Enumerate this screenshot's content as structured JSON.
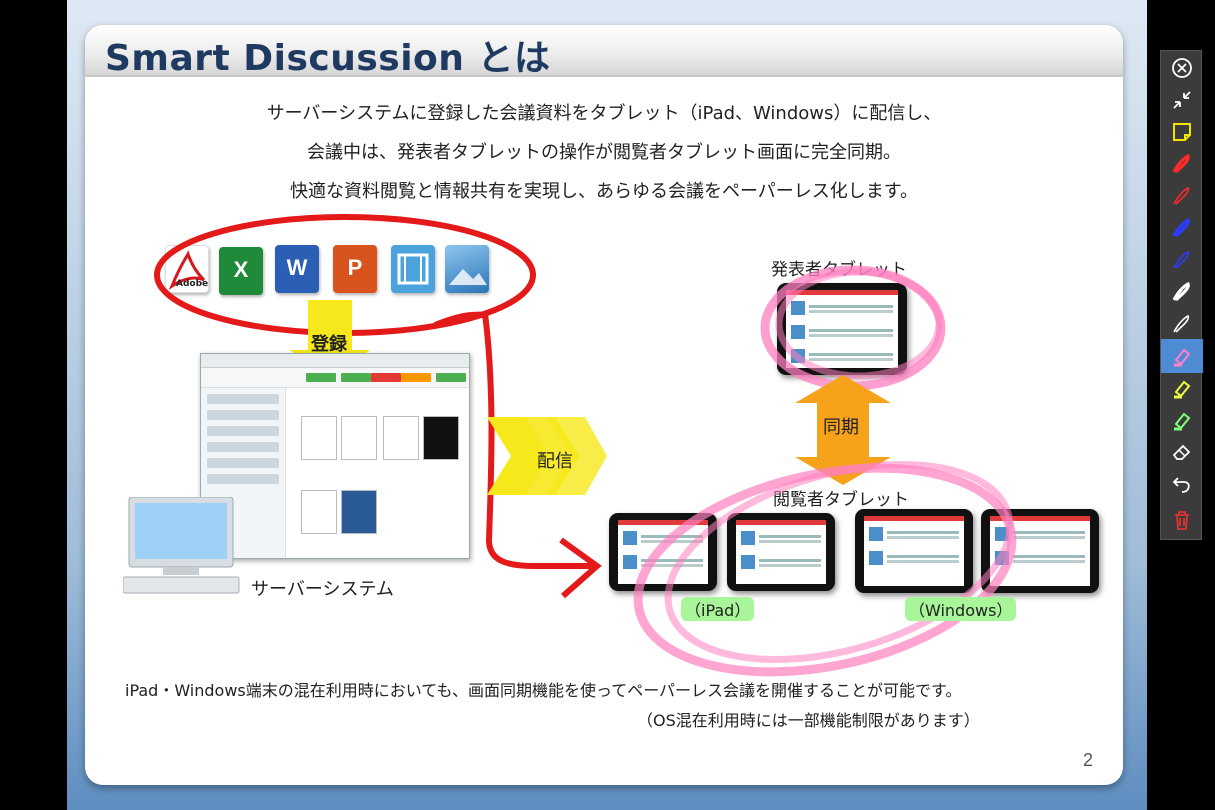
{
  "slide": {
    "title": "Smart Discussion とは",
    "intro_lines": [
      "サーバーシステムに登録した会議資料をタブレット（iPad、Windows）に配信し、",
      "会議中は、発表者タブレットの操作が閲覧者タブレット画面に完全同期。",
      "快適な資料閲覧と情報共有を実現し、あらゆる会議をペーパーレス化します。"
    ],
    "diagram": {
      "register_label": "登録",
      "deliver_label": "配信",
      "sync_label": "同期",
      "presenter_label": "発表者タブレット",
      "viewer_label": "閲覧者タブレット",
      "server_label": "サーバーシステム",
      "ipad_label": "（iPad）",
      "windows_label": "（Windows）",
      "file_icons": [
        "pdf-icon",
        "excel-icon",
        "word-icon",
        "powerpoint-icon",
        "video-icon",
        "image-icon"
      ],
      "pdf_badge": "Adobe"
    },
    "footnote_1": "iPad・Windows端末の混在利用時においても、画面同期機能を使ってペーパーレス会議を開催することが可能です。",
    "footnote_2": "（OS混在利用時には一部機能制限があります）",
    "page_number": "2"
  },
  "toolbar": {
    "tools": [
      {
        "name": "close-icon",
        "color": "#ffffff"
      },
      {
        "name": "collapse-icon",
        "color": "#ffffff"
      },
      {
        "name": "sticky-note-icon",
        "color": "#f2e600"
      },
      {
        "name": "pen-red-thick-icon",
        "color": "#ff2a2a"
      },
      {
        "name": "pen-red-thin-icon",
        "color": "#ff2a2a"
      },
      {
        "name": "pen-blue-thick-icon",
        "color": "#2a3cff"
      },
      {
        "name": "pen-blue-thin-icon",
        "color": "#2a3cff"
      },
      {
        "name": "pen-black-thick-icon",
        "color": "#ffffff"
      },
      {
        "name": "pen-black-thin-icon",
        "color": "#ffffff"
      },
      {
        "name": "highlighter-pink-icon",
        "color": "#ff7fd0",
        "active": true
      },
      {
        "name": "highlighter-yellow-icon",
        "color": "#eaff3a"
      },
      {
        "name": "highlighter-green-icon",
        "color": "#7dff7a"
      },
      {
        "name": "eraser-icon",
        "color": "#ffffff"
      },
      {
        "name": "undo-icon",
        "color": "#ffffff"
      },
      {
        "name": "trash-icon",
        "color": "#e03232"
      }
    ]
  }
}
